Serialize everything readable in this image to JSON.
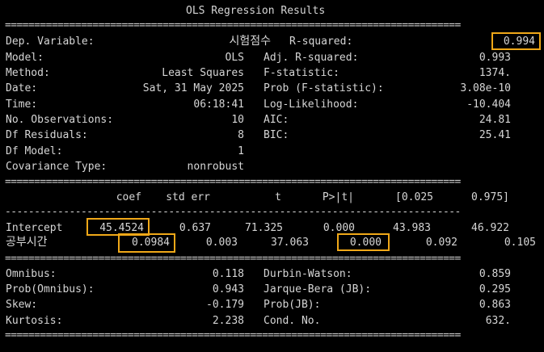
{
  "title": "OLS Regression Results",
  "rules": {
    "double": "==============================================================================",
    "single": "------------------------------------------------------------------------------"
  },
  "summary_left": [
    {
      "label": "Dep. Variable:",
      "value": "시험점수"
    },
    {
      "label": "Model:",
      "value": "OLS"
    },
    {
      "label": "Method:",
      "value": "Least Squares"
    },
    {
      "label": "Date:",
      "value": "Sat, 31 May 2025"
    },
    {
      "label": "Time:",
      "value": "06:18:41"
    },
    {
      "label": "No. Observations:",
      "value": "10"
    },
    {
      "label": "Df Residuals:",
      "value": "8"
    },
    {
      "label": "Df Model:",
      "value": "1"
    },
    {
      "label": "Covariance Type:",
      "value": "nonrobust"
    }
  ],
  "summary_right": [
    {
      "label": "R-squared:",
      "value": "0.994"
    },
    {
      "label": "Adj. R-squared:",
      "value": "0.993"
    },
    {
      "label": "F-statistic:",
      "value": "1374."
    },
    {
      "label": "Prob (F-statistic):",
      "value": "3.08e-10"
    },
    {
      "label": "Log-Likelihood:",
      "value": "-10.404"
    },
    {
      "label": "AIC:",
      "value": "24.81"
    },
    {
      "label": "BIC:",
      "value": "25.41"
    }
  ],
  "coef_table": {
    "headers": [
      "coef",
      "std err",
      "t",
      "P>|t|",
      "[0.025",
      "0.975]"
    ],
    "rows": [
      {
        "name": "Intercept",
        "coef": "45.4524",
        "std_err": "0.637",
        "t": "71.325",
        "p": "0.000",
        "ci_low": "43.983",
        "ci_high": "46.922"
      },
      {
        "name": "공부시간",
        "coef": "0.0984",
        "std_err": "0.003",
        "t": "37.063",
        "p": "0.000",
        "ci_low": "0.092",
        "ci_high": "0.105"
      }
    ]
  },
  "diagnostics_left": [
    {
      "label": "Omnibus:",
      "value": "0.118"
    },
    {
      "label": "Prob(Omnibus):",
      "value": "0.943"
    },
    {
      "label": "Skew:",
      "value": "-0.179"
    },
    {
      "label": "Kurtosis:",
      "value": "2.238"
    }
  ],
  "diagnostics_right": [
    {
      "label": "Durbin-Watson:",
      "value": "0.859"
    },
    {
      "label": "Jarque-Bera (JB):",
      "value": "0.295"
    },
    {
      "label": "Prob(JB):",
      "value": "0.863"
    },
    {
      "label": "Cond. No.",
      "value": "632."
    }
  ],
  "highlight_color": "#f0a818"
}
